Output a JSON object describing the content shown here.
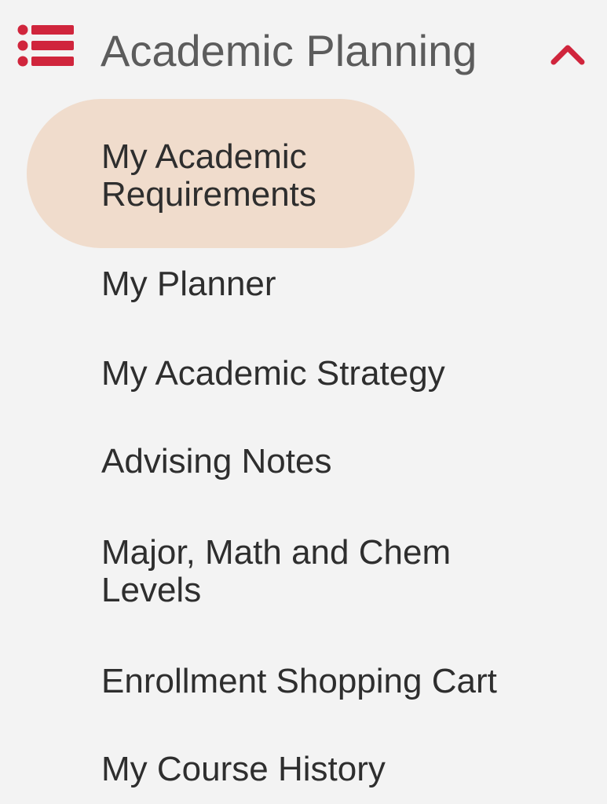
{
  "section": {
    "title": "Academic Planning",
    "icon": "list-icon",
    "toggle_icon": "chevron-up-icon",
    "expanded": true
  },
  "colors": {
    "accent": "#d0253c",
    "active_bg": "#f0dccc",
    "panel_bg": "#f3f3f3",
    "title_text": "#5c5c5c",
    "item_text": "#2e2e2e"
  },
  "menu": {
    "items": [
      {
        "lines": [
          "My Academic",
          "Requirements"
        ],
        "active": true
      },
      {
        "lines": [
          "My Planner"
        ],
        "active": false
      },
      {
        "lines": [
          "My Academic Strategy"
        ],
        "active": false
      },
      {
        "lines": [
          "Advising Notes"
        ],
        "active": false
      },
      {
        "lines": [
          "Major, Math and Chem",
          "Levels"
        ],
        "active": false
      },
      {
        "lines": [
          "Enrollment Shopping Cart"
        ],
        "active": false
      },
      {
        "lines": [
          "My Course History"
        ],
        "active": false
      }
    ]
  }
}
